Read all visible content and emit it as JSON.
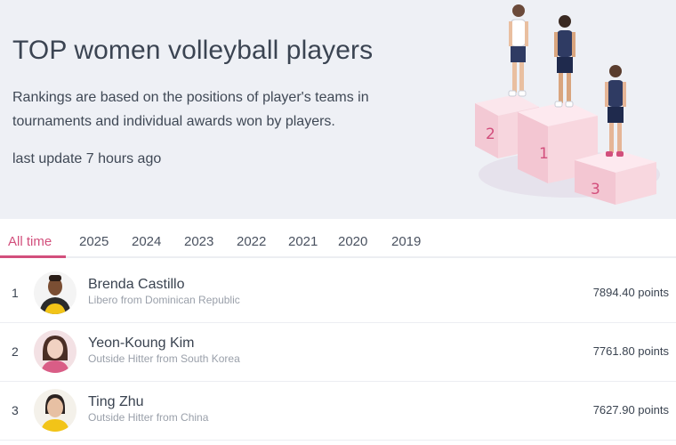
{
  "hero": {
    "title": "TOP women volleyball players",
    "description": "Rankings are based on the positions of player's teams in tournaments and individual awards won by players.",
    "last_update": "last update 7 hours ago",
    "podium_labels": [
      "2",
      "1",
      "3"
    ]
  },
  "tabs": [
    {
      "label": "All time",
      "active": true
    },
    {
      "label": "2025",
      "active": false
    },
    {
      "label": "2024",
      "active": false
    },
    {
      "label": "2023",
      "active": false
    },
    {
      "label": "2022",
      "active": false
    },
    {
      "label": "2021",
      "active": false
    },
    {
      "label": "2020",
      "active": false
    },
    {
      "label": "2019",
      "active": false
    }
  ],
  "players": [
    {
      "rank": "1",
      "name": "Brenda Castillo",
      "desc": "Libero from Dominican Republic",
      "points": "7894.40 points"
    },
    {
      "rank": "2",
      "name": "Yeon-Koung Kim",
      "desc": "Outside Hitter from South Korea",
      "points": "7761.80 points"
    },
    {
      "rank": "3",
      "name": "Ting Zhu",
      "desc": "Outside Hitter from China",
      "points": "7627.90 points"
    }
  ],
  "colors": {
    "accent": "#d24f7c",
    "hero_bg": "#eef0f5",
    "podium": "#f7d4dd",
    "jersey": "#2f3b63"
  }
}
